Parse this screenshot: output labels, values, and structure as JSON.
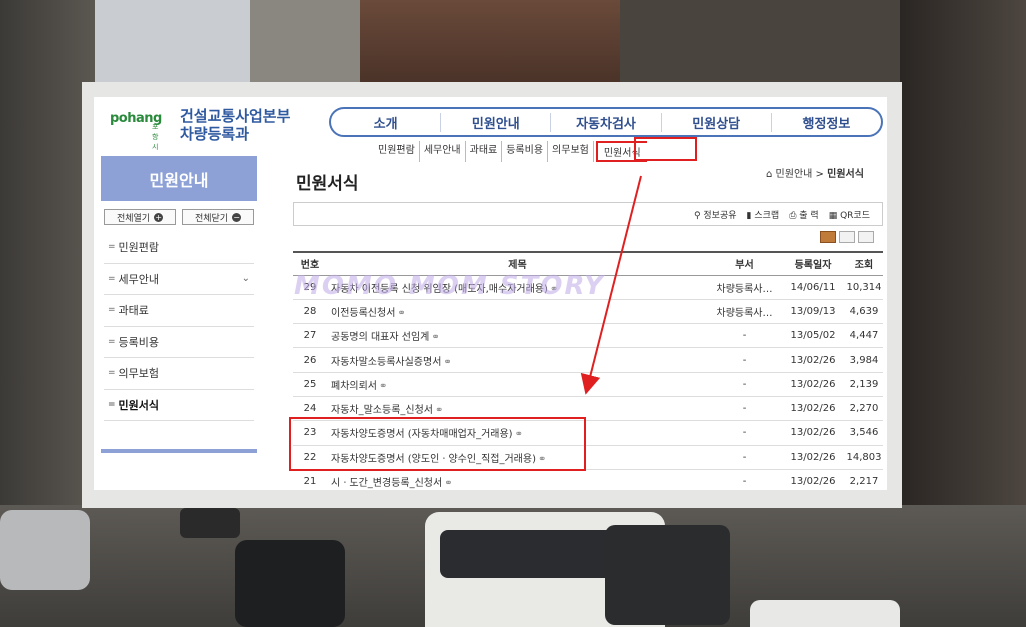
{
  "site": {
    "logo_text": "pohang",
    "logo_sub": "포항시",
    "dept_line1": "건설교통사업본부",
    "dept_line2": "차량등록과"
  },
  "topnav": [
    "소개",
    "민원안내",
    "자동차검사",
    "민원상담",
    "행정정보"
  ],
  "subnav": {
    "items": [
      "민원편람",
      "세무안내",
      "과태료",
      "등록비용",
      "의무보험"
    ],
    "active": "민원서식"
  },
  "sidebar": {
    "heading": "민원안내",
    "expand_all": "전체열기",
    "collapse_all": "전체닫기",
    "items": [
      "민원편람",
      "세무안내",
      "과태료",
      "등록비용",
      "의무보험",
      "민원서식"
    ]
  },
  "main": {
    "title": "민원서식",
    "breadcrumb_parent": "민원안내",
    "breadcrumb_current": "민원서식",
    "toolbar": [
      "정보공유",
      "스크랩",
      "출 력",
      "QR코드"
    ]
  },
  "table": {
    "headers": [
      "번호",
      "제목",
      "부서",
      "등록일자",
      "조회"
    ],
    "rows": [
      {
        "no": "29",
        "title": "자동차 이전등록 신청 위임장 (매도자,매수자거래용)",
        "dept": "차량등록사…",
        "date": "14/06/11",
        "views": "10,314"
      },
      {
        "no": "28",
        "title": "이전등록신청서",
        "dept": "차량등록사…",
        "date": "13/09/13",
        "views": "4,639"
      },
      {
        "no": "27",
        "title": "공동명의 대표자 선임계",
        "dept": "-",
        "date": "13/05/02",
        "views": "4,447"
      },
      {
        "no": "26",
        "title": "자동차말소등록사실증명서",
        "dept": "-",
        "date": "13/02/26",
        "views": "3,984"
      },
      {
        "no": "25",
        "title": "폐차의뢰서",
        "dept": "-",
        "date": "13/02/26",
        "views": "2,139"
      },
      {
        "no": "24",
        "title": "자동차_말소등록_신청서",
        "dept": "-",
        "date": "13/02/26",
        "views": "2,270"
      },
      {
        "no": "23",
        "title": "자동차양도증명서 (자동차매매업자_거래용)",
        "dept": "-",
        "date": "13/02/26",
        "views": "3,546"
      },
      {
        "no": "22",
        "title": "자동차양도증명서 (양도인ㆍ양수인_직접_거래용)",
        "dept": "-",
        "date": "13/02/26",
        "views": "14,803"
      },
      {
        "no": "21",
        "title": "시ㆍ도간_변경등록_신청서",
        "dept": "-",
        "date": "13/02/26",
        "views": "2,217"
      }
    ]
  },
  "watermark": "MOMO MOM STORY",
  "colors": {
    "accent": "#8ea1d6",
    "nav_border": "#4a73b8",
    "annotation": "#e02020"
  }
}
